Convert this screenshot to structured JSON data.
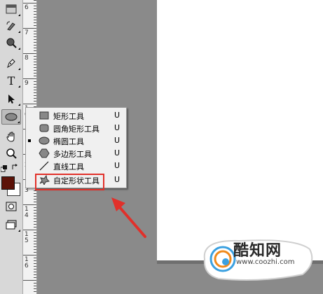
{
  "toolbar": {
    "tools": [
      {
        "name": "marquee-tool",
        "icon": "marquee-icon"
      },
      {
        "name": "history-brush-tool",
        "icon": "history-brush-icon"
      },
      {
        "name": "quick-select-tool",
        "icon": "quick-select-icon"
      },
      {
        "name": "pen-tool",
        "icon": "pen-icon"
      },
      {
        "name": "type-tool",
        "icon": "type-icon",
        "glyph": "T"
      },
      {
        "name": "path-select-tool",
        "icon": "arrow-icon"
      },
      {
        "name": "ellipse-tool",
        "icon": "ellipse-icon",
        "active": true
      },
      {
        "name": "hand-tool",
        "icon": "hand-icon"
      },
      {
        "name": "zoom-tool",
        "icon": "zoom-icon"
      }
    ],
    "foreground_color": "#5c1208",
    "background_color": "#ffffff"
  },
  "ruler": {
    "labels": [
      "6",
      "7",
      "8",
      "9",
      "1\n0",
      "1\n1",
      "1\n2",
      "1\n3",
      "1\n4",
      "1\n5",
      "1\n6"
    ]
  },
  "flyout": {
    "items": [
      {
        "label": "矩形工具",
        "key": "U",
        "icon": "rectangle-icon",
        "selected": false
      },
      {
        "label": "圆角矩形工具",
        "key": "U",
        "icon": "rounded-rectangle-icon",
        "selected": false
      },
      {
        "label": "椭圆工具",
        "key": "U",
        "icon": "ellipse-icon",
        "selected": true
      },
      {
        "label": "多边形工具",
        "key": "U",
        "icon": "polygon-icon",
        "selected": false
      },
      {
        "label": "直线工具",
        "key": "U",
        "icon": "line-icon",
        "selected": false
      },
      {
        "label": "自定形状工具",
        "key": "U",
        "icon": "custom-shape-icon",
        "selected": false
      }
    ]
  },
  "annotation": {
    "highlight_color": "#e1302a"
  },
  "watermark": {
    "name": "酷知网",
    "url": "www.coozhi.com"
  }
}
